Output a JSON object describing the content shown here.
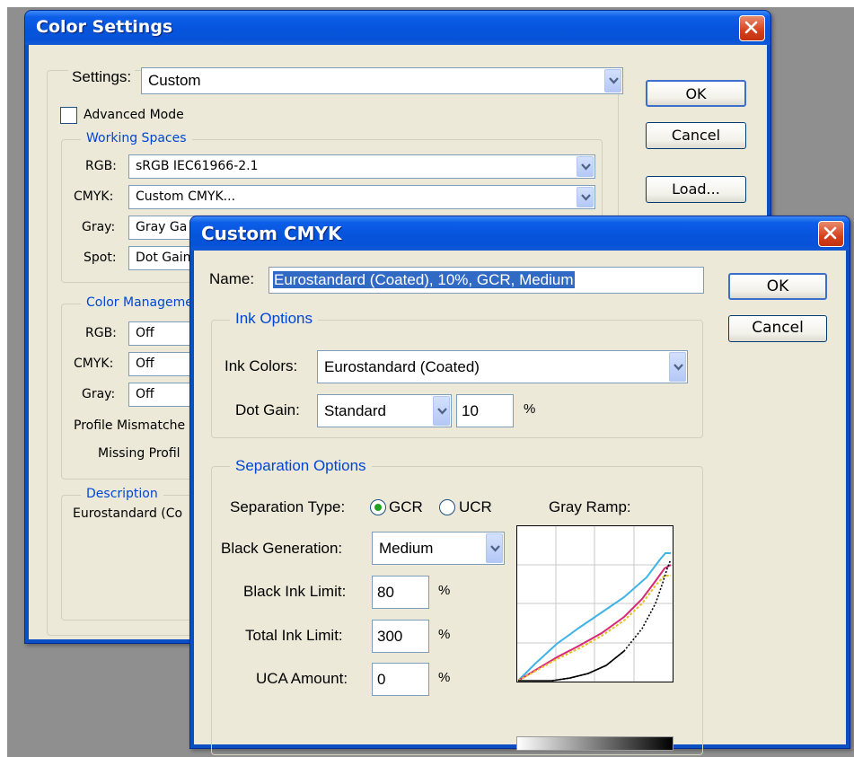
{
  "color_settings": {
    "title": "Color Settings",
    "settings_label": "Settings:",
    "settings_value": "Custom",
    "advanced_mode_label": "Advanced Mode",
    "advanced_mode_checked": false,
    "working_spaces": {
      "title": "Working Spaces",
      "rgb_label": "RGB:",
      "rgb_value": "sRGB IEC61966-2.1",
      "cmyk_label": "CMYK:",
      "cmyk_value": "Custom CMYK...",
      "gray_label": "Gray:",
      "gray_value": "Gray Ga",
      "spot_label": "Spot:",
      "spot_value": "Dot Gain"
    },
    "color_management": {
      "title": "Color Manageme",
      "rgb_label": "RGB:",
      "rgb_value": "Off",
      "cmyk_label": "CMYK:",
      "cmyk_value": "Off",
      "gray_label": "Gray:",
      "gray_value": "Off",
      "profile_mismatch_label": "Profile Mismatche",
      "missing_profile_label": "Missing Profil"
    },
    "description": {
      "title": "Description",
      "text": "Eurostandard (Co"
    },
    "buttons": {
      "ok": "OK",
      "cancel": "Cancel",
      "load": "Load..."
    }
  },
  "custom_cmyk": {
    "title": "Custom CMYK",
    "name_label": "Name:",
    "name_value": "Eurostandard (Coated), 10%, GCR, Medium",
    "buttons": {
      "ok": "OK",
      "cancel": "Cancel"
    },
    "ink_options": {
      "title": "Ink Options",
      "ink_colors_label": "Ink Colors:",
      "ink_colors_value": "Eurostandard (Coated)",
      "dot_gain_label": "Dot Gain:",
      "dot_gain_value": "Standard",
      "dot_gain_percent": "10",
      "percent_sign": "%"
    },
    "separation_options": {
      "title": "Separation Options",
      "separation_type_label": "Separation Type:",
      "gcr_label": "GCR",
      "ucr_label": "UCR",
      "selected_type": "GCR",
      "gray_ramp_label": "Gray Ramp:",
      "black_generation_label": "Black Generation:",
      "black_generation_value": "Medium",
      "black_ink_limit_label": "Black Ink Limit:",
      "black_ink_limit_value": "80",
      "total_ink_limit_label": "Total Ink Limit:",
      "total_ink_limit_value": "300",
      "uca_amount_label": "UCA Amount:",
      "uca_amount_value": "0",
      "percent_sign": "%"
    }
  },
  "colors": {
    "titlebar_blue": "#0754dc",
    "dialog_face": "#ece9d8",
    "group_title_blue": "#0046d5",
    "close_red": "#d6411d",
    "selection_blue": "#316ac5",
    "ramp_cyan": "#3fb2e6",
    "ramp_magenta": "#d8287a",
    "ramp_yellow": "#e8c020",
    "ramp_black": "#000000"
  }
}
